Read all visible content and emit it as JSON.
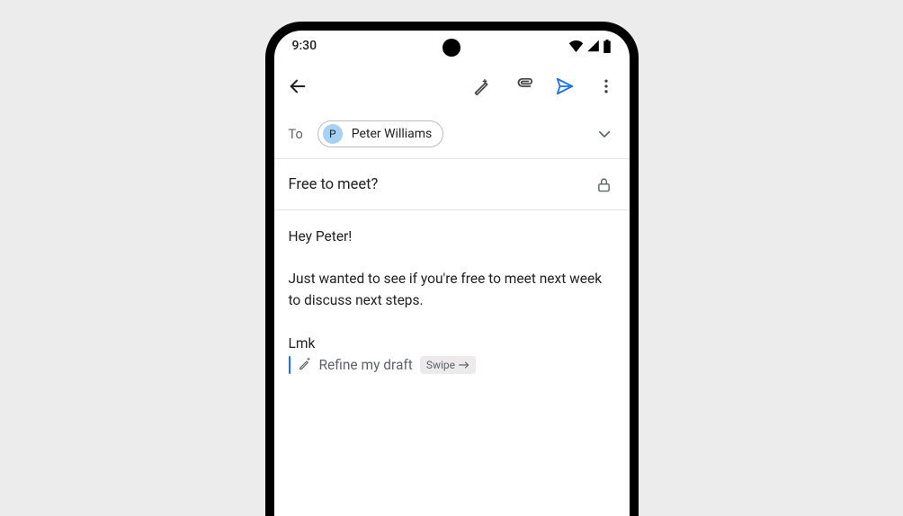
{
  "status_bar": {
    "time": "9:30"
  },
  "compose": {
    "to_label": "To",
    "recipient": {
      "initial": "P",
      "name": "Peter Williams"
    },
    "subject": "Free to meet?",
    "body": "Hey Peter!\n\nJust wanted to see if you're free to meet next week to discuss next steps.\n\nLmk",
    "refine": {
      "label": "Refine my draft",
      "swipe_label": "Swipe"
    }
  }
}
